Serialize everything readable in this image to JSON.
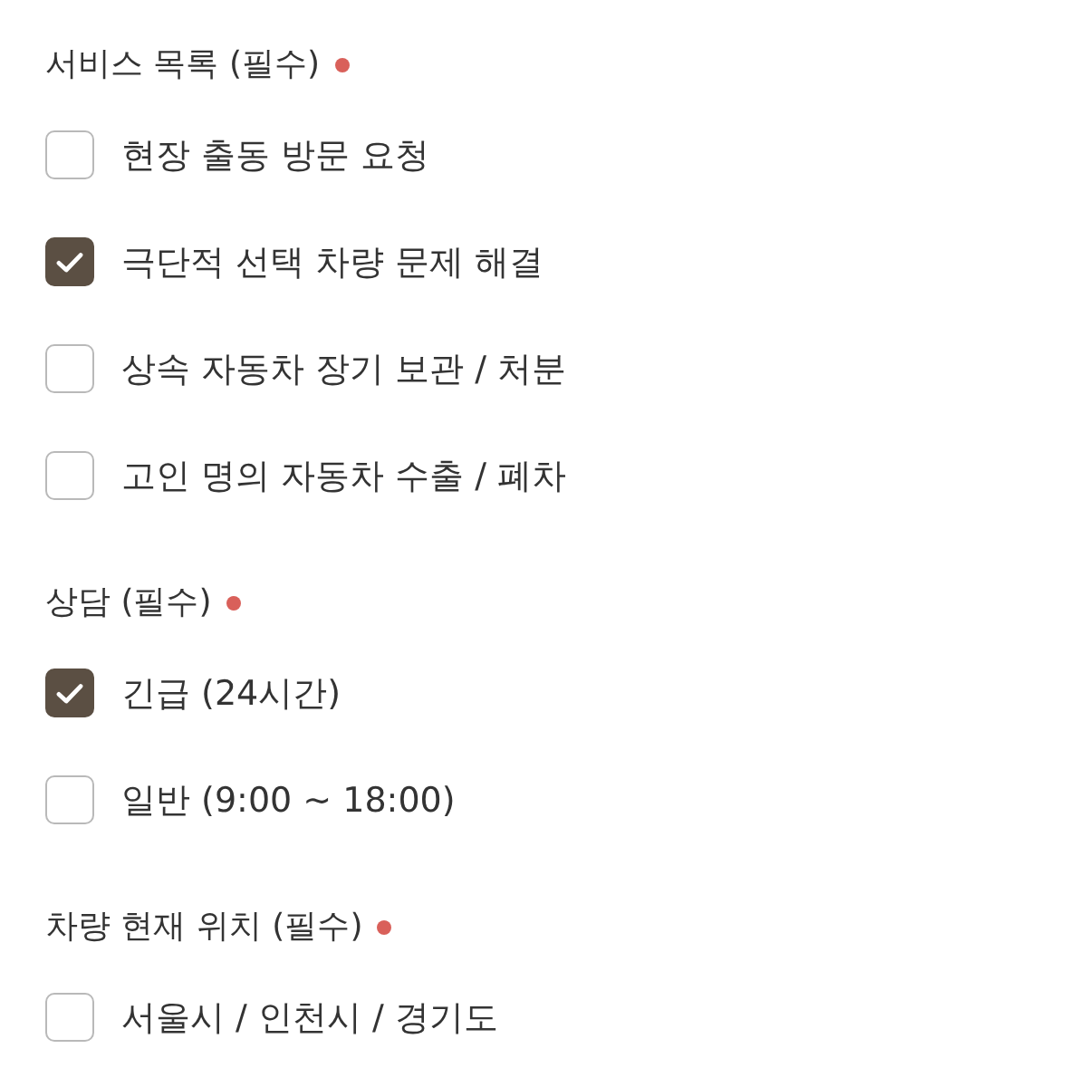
{
  "sections": [
    {
      "title": "서비스 목록 (필수)",
      "required": true,
      "options": [
        {
          "label": "현장 출동 방문 요청",
          "checked": false
        },
        {
          "label": "극단적 선택 차량 문제 해결",
          "checked": true
        },
        {
          "label": "상속 자동차 장기 보관 / 처분",
          "checked": false
        },
        {
          "label": "고인 명의 자동차 수출 / 폐차",
          "checked": false
        }
      ]
    },
    {
      "title": "상담 (필수)",
      "required": true,
      "options": [
        {
          "label": "긴급 (24시간)",
          "checked": true
        },
        {
          "label": "일반 (9:00 ~ 18:00)",
          "checked": false
        }
      ]
    },
    {
      "title": "차량 현재 위치 (필수)",
      "required": true,
      "options": [
        {
          "label": "서울시 / 인천시 / 경기도",
          "checked": false
        }
      ]
    }
  ]
}
